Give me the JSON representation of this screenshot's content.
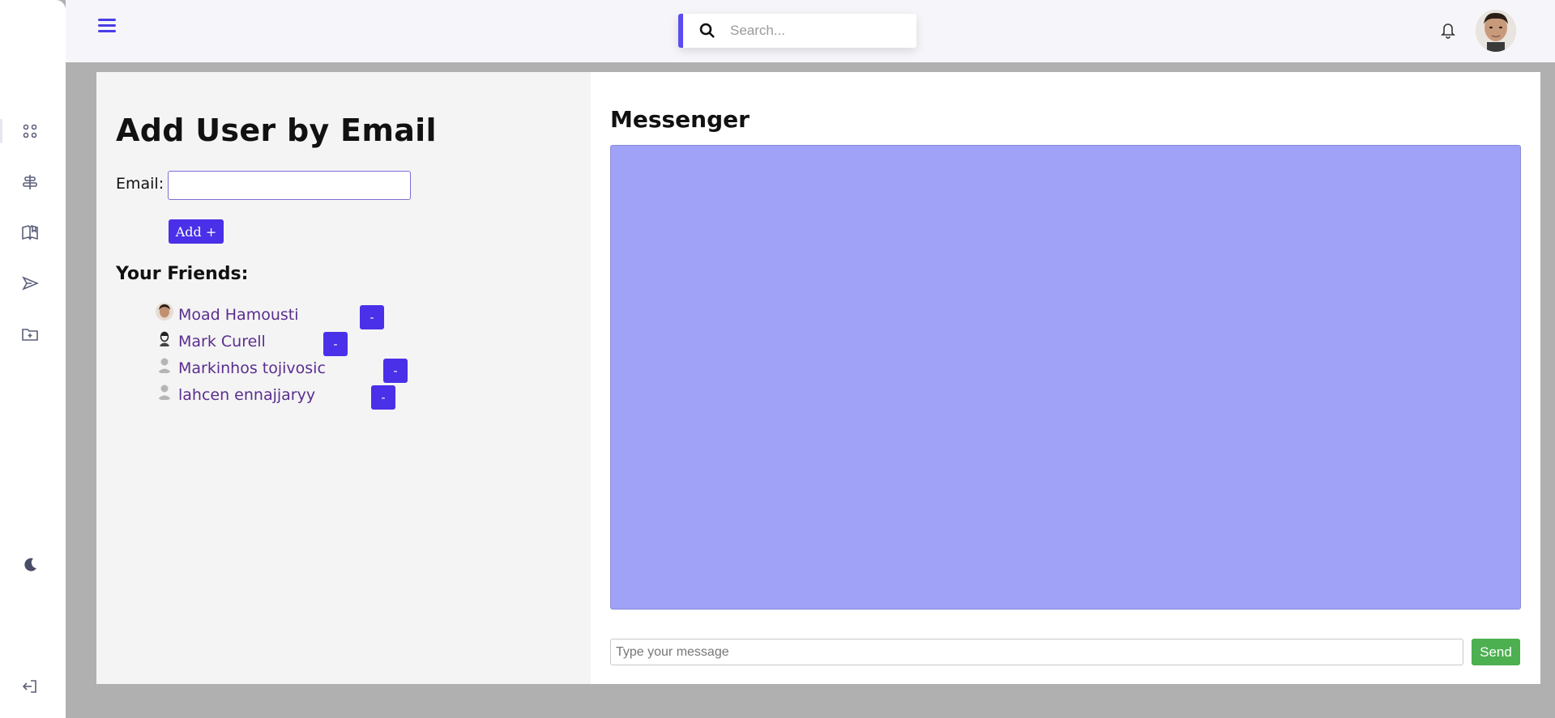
{
  "header": {
    "search_placeholder": "Search..."
  },
  "sidebar": {
    "icons": [
      "apps-icon",
      "align-icon",
      "book-icon",
      "send-icon",
      "folder-plus-icon",
      "moon-icon",
      "logout-icon"
    ]
  },
  "add_user": {
    "title": "Add User by Email",
    "email_label": "Email:",
    "email_value": "",
    "add_button": "Add +"
  },
  "friends": {
    "title": "Your Friends:",
    "items": [
      {
        "name": "Moad Hamousti",
        "remove_label": "-"
      },
      {
        "name": "Mark Curell",
        "remove_label": "-"
      },
      {
        "name": "Markinhos tojivosic",
        "remove_label": "-"
      },
      {
        "name": "lahcen ennajjaryy",
        "remove_label": "-"
      }
    ]
  },
  "messenger": {
    "title": "Messenger",
    "input_placeholder": "Type your message",
    "send_button": "Send"
  },
  "colors": {
    "accent": "#4a30e8",
    "chat_bg": "#a0a2f7",
    "send": "#4caf50",
    "friend_link": "#5a2d8f"
  }
}
